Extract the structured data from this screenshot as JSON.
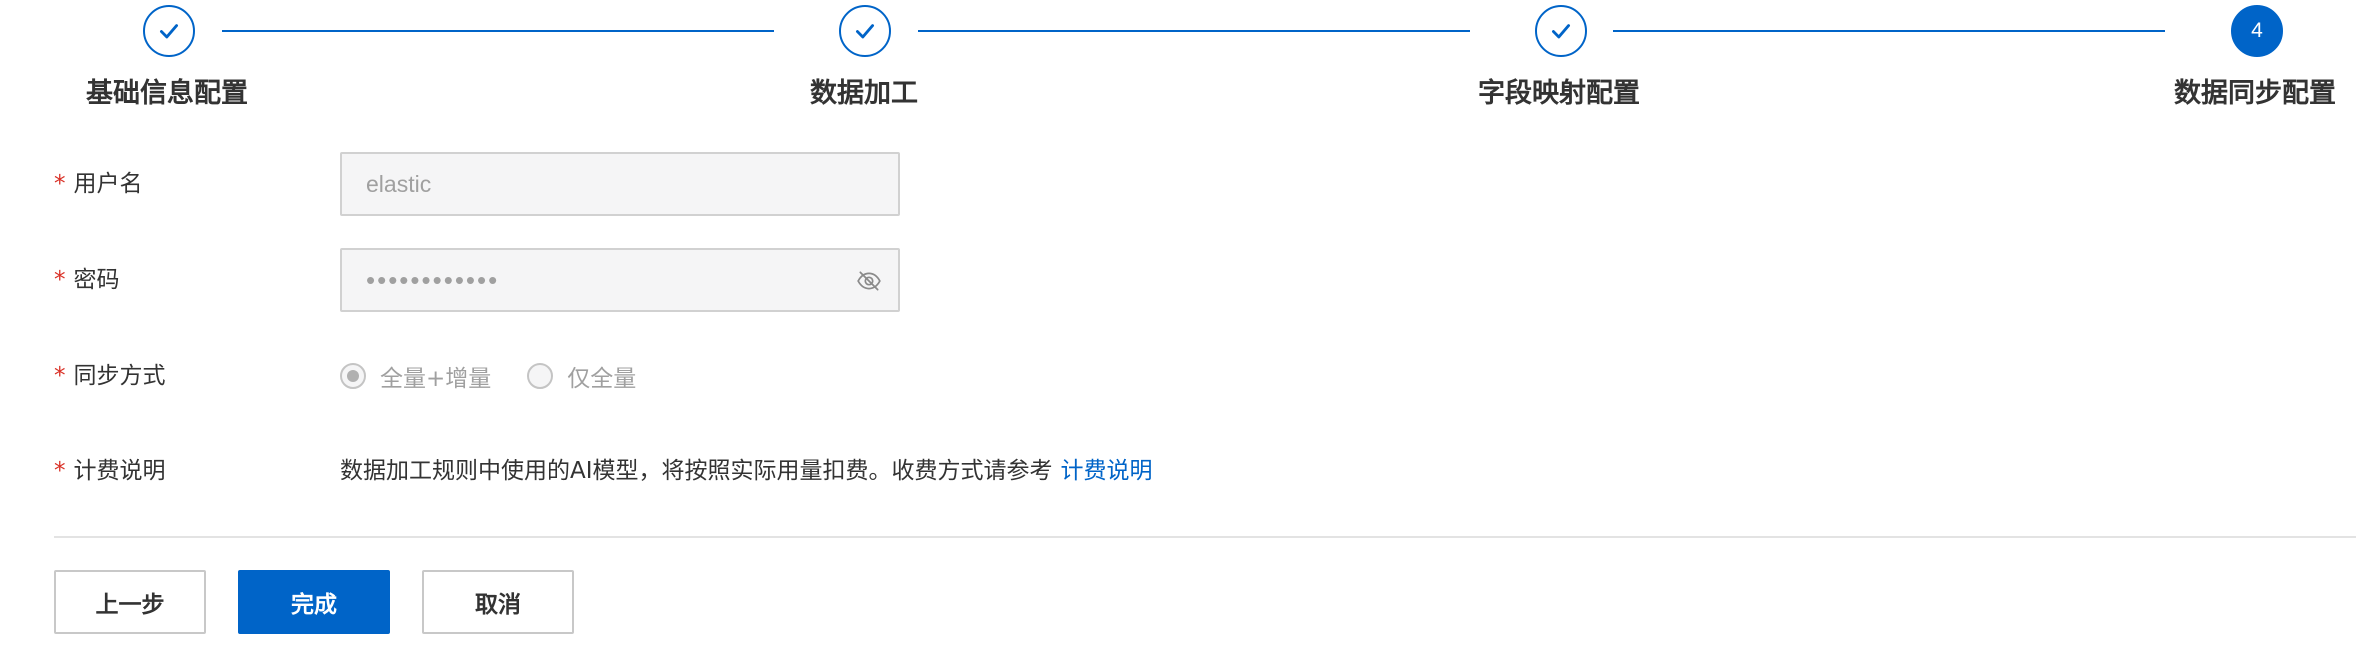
{
  "steps": [
    {
      "number": "1",
      "title": "基础信息配置",
      "status": "done",
      "icon": "check-icon"
    },
    {
      "number": "2",
      "title": "数据加工",
      "status": "done",
      "icon": "check-icon"
    },
    {
      "number": "3",
      "title": "字段映射配置",
      "status": "done",
      "icon": "check-icon"
    },
    {
      "number": "4",
      "title": "数据同步配置",
      "status": "active"
    }
  ],
  "form": {
    "username": {
      "label": "用户名",
      "value": "elastic"
    },
    "password": {
      "label": "密码",
      "masked_value": "••••••••••••",
      "toggle_icon": "eye-off-icon"
    },
    "sync_mode": {
      "label": "同步方式",
      "options": [
        {
          "label": "全量+增量",
          "selected": true
        },
        {
          "label": "仅全量",
          "selected": false
        }
      ]
    },
    "billing": {
      "label": "计费说明",
      "text": "数据加工规则中使用的AI模型，将按照实际用量扣费。收费方式请参考",
      "link_text": "计费说明"
    },
    "required_mark": "*"
  },
  "buttons": {
    "prev": "上一步",
    "finish": "完成",
    "cancel": "取消"
  },
  "colors": {
    "primary": "#0064c8",
    "required": "#d93026",
    "disabled_text": "#a0a0a0",
    "border": "#d1d1d1"
  }
}
